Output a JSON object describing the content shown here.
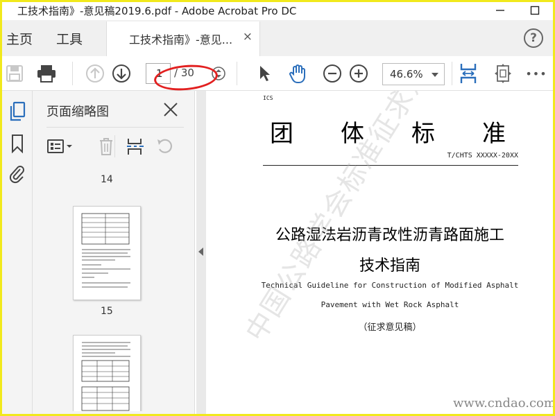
{
  "window": {
    "title": "工技术指南》-意见稿2019.6.pdf - Adobe Acrobat Pro DC",
    "minimize_icon": "minimize-icon",
    "maximize_icon": "maximize-icon"
  },
  "nav": {
    "home": "主页",
    "tools": "工具",
    "tab_label": "工技术指南》-意见...",
    "tab_close": "×",
    "help": "?"
  },
  "toolbar": {
    "page_current": "1",
    "page_total": "/ 30",
    "zoom": "46.6%",
    "icons": [
      "save-icon",
      "print-icon",
      "page-up-icon",
      "page-down-icon",
      "page-stepper-icon",
      "select-cursor-icon",
      "hand-tool-icon",
      "zoom-out-icon",
      "zoom-in-icon",
      "fit-width-icon",
      "fit-page-icon",
      "more-icon"
    ],
    "more": "•••"
  },
  "panel": {
    "title": "页面缩略图",
    "thumbnails": [
      {
        "label": "14"
      },
      {
        "label": "15"
      }
    ]
  },
  "document": {
    "ics": "ICS",
    "standard_chars": [
      "团",
      "体",
      "标",
      "准"
    ],
    "code": "T/CHTS XXXXX-20XX",
    "title_cn_line1": "公路湿法岩沥青改性沥青路面施工",
    "title_cn_line2": "技术指南",
    "title_en_line1": "Technical Guideline for Construction of Modified Asphalt",
    "title_en_line2": "Pavement with Wet Rock Asphalt",
    "draft_note": "（征求意见稿）",
    "watermark": "中国公路学会标准征求意见稿",
    "site_mark": "www.cndao.com"
  },
  "colors": {
    "accent_blue": "#2a6ebb",
    "annotation_red": "#e22020",
    "frame_yellow": "#f1e91c"
  }
}
